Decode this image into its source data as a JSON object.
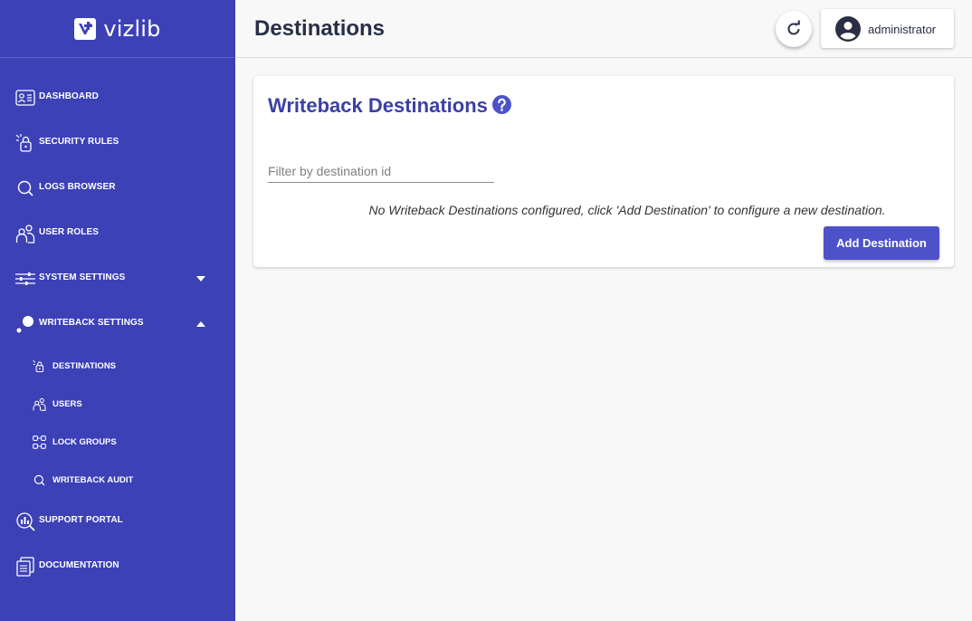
{
  "brand": {
    "name": "vizlib"
  },
  "colors": {
    "sidebar": "#3d41b6",
    "accent": "#3b3fa6",
    "button": "#4e52c8",
    "title": "#2a2f45"
  },
  "sidebar": {
    "items": [
      {
        "label": "DASHBOARD",
        "icon": "id-card-icon"
      },
      {
        "label": "SECURITY RULES",
        "icon": "lock-click-icon"
      },
      {
        "label": "LOGS BROWSER",
        "icon": "search-icon"
      },
      {
        "label": "USER ROLES",
        "icon": "users-icon"
      },
      {
        "label": "SYSTEM SETTINGS",
        "icon": "sliders-icon",
        "expanded": false
      },
      {
        "label": "WRITEBACK SETTINGS",
        "icon": "writeback-icon",
        "expanded": true
      },
      {
        "label": "SUPPORT PORTAL",
        "icon": "support-icon"
      },
      {
        "label": "DOCUMENTATION",
        "icon": "documents-icon"
      }
    ],
    "writeback_sub": [
      {
        "label": "DESTINATIONS",
        "icon": "lock-click-icon"
      },
      {
        "label": "USERS",
        "icon": "users-icon"
      },
      {
        "label": "LOCK GROUPS",
        "icon": "lock-groups-icon"
      },
      {
        "label": "WRITEBACK AUDIT",
        "icon": "search-icon"
      }
    ]
  },
  "header": {
    "title": "Destinations",
    "user": "administrator"
  },
  "card": {
    "title": "Writeback Destinations",
    "filter_placeholder": "Filter by destination id",
    "filter_value": "",
    "empty_message": "No Writeback Destinations configured, click 'Add Destination' to configure a new destination.",
    "add_button": "Add Destination"
  }
}
